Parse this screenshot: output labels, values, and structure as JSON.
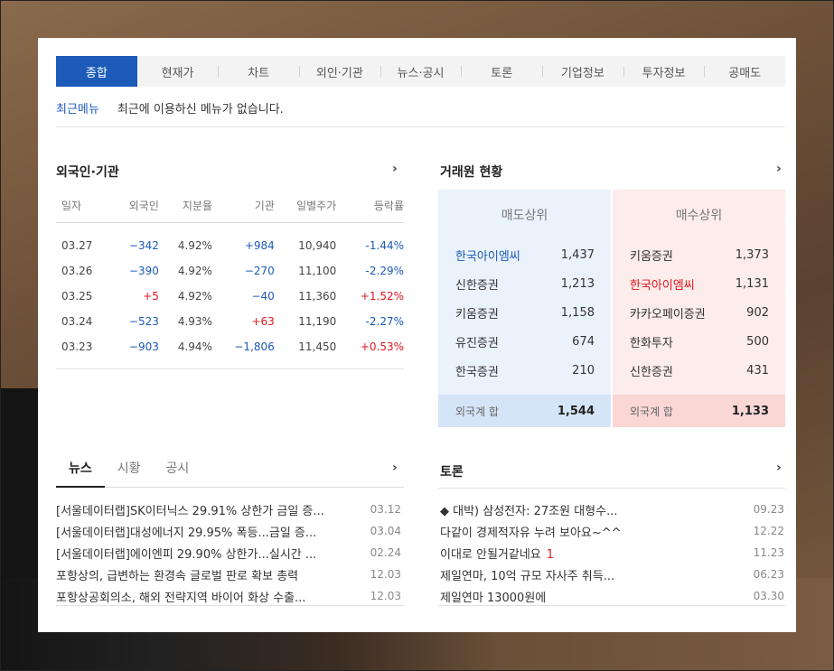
{
  "tabs": [
    "종합",
    "현재가",
    "차트",
    "외인·기관",
    "뉴스·공시",
    "토론",
    "기업정보",
    "투자정보",
    "공매도"
  ],
  "recent": {
    "label": "최근메뉴",
    "message": "최근에 이용하신 메뉴가 없습니다."
  },
  "foreign": {
    "title": "외국인·기관",
    "headers": [
      "일자",
      "외국인",
      "지분율",
      "기관",
      "일별주가",
      "등락률"
    ],
    "rows": [
      [
        "03.27",
        "−342",
        "4.92%",
        "+984",
        "10,940",
        "-1.44%"
      ],
      [
        "03.26",
        "−390",
        "4.92%",
        "−270",
        "11,100",
        "-2.29%"
      ],
      [
        "03.25",
        "+5",
        "4.92%",
        "−40",
        "11,360",
        "+1.52%"
      ],
      [
        "03.24",
        "−523",
        "4.93%",
        "+63",
        "11,190",
        "-2.27%"
      ],
      [
        "03.23",
        "−903",
        "4.94%",
        "−1,806",
        "11,450",
        "+0.53%"
      ]
    ],
    "signs": [
      [
        "neg",
        "neg",
        "pos",
        "neg"
      ],
      [
        "neg",
        "neg",
        "neg",
        "neg"
      ],
      [
        "pos",
        "neg",
        "pos",
        "pos"
      ],
      [
        "neg",
        "pos",
        "neg",
        "neg"
      ],
      [
        "neg",
        "neg",
        "pos",
        "pos"
      ]
    ]
  },
  "broker": {
    "title": "거래원 현황",
    "sell": {
      "header": "매도상위",
      "rows": [
        [
          "한국아이엠씨",
          "1,437"
        ],
        [
          "신한증권",
          "1,213"
        ],
        [
          "키움증권",
          "1,158"
        ],
        [
          "유진증권",
          "674"
        ],
        [
          "한국증권",
          "210"
        ]
      ],
      "foot_label": "외국계 합",
      "foot_value": "1,544"
    },
    "buy": {
      "header": "매수상위",
      "rows": [
        [
          "키움증권",
          "1,373"
        ],
        [
          "한국아이엠씨",
          "1,131"
        ],
        [
          "카카오페이증권",
          "902"
        ],
        [
          "한화투자",
          "500"
        ],
        [
          "신한증권",
          "431"
        ]
      ],
      "foot_label": "외국계 합",
      "foot_value": "1,133"
    }
  },
  "news": {
    "tabs": [
      "뉴스",
      "시황",
      "공시"
    ],
    "items": [
      [
        "[서울데이터랩]SK이터닉스 29.91% 상한가 금일 증...",
        "03.12"
      ],
      [
        "[서울데이터랩]대성에너지 29.95% 폭등...금일 증...",
        "03.04"
      ],
      [
        "[서울데이터랩]에이엔피 29.90% 상한가...실시간 ...",
        "02.24"
      ],
      [
        "포항상의, 급변하는 환경속 글로벌 판로 확보 총력",
        "12.03"
      ],
      [
        "포항상공회의소, 해외 전략지역 바이어 화상 수출...",
        "12.03"
      ]
    ]
  },
  "board": {
    "title": "토론",
    "items": [
      [
        "◆ 대박) 삼성전자: 27조원 대형수...",
        "09.23",
        ""
      ],
      [
        "다같이 경제적자유 누려 보아요~^^",
        "12.22",
        ""
      ],
      [
        "이대로 안될거같네요",
        "11.23",
        "1"
      ],
      [
        "제일연마, 10억 규모 자사주 취득...",
        "06.23",
        ""
      ],
      [
        "제일연마 13000원에",
        "03.30",
        ""
      ]
    ]
  },
  "colors": {
    "accent": "#1c5bb8",
    "up": "#e0161c",
    "down": "#1c5bb8"
  }
}
